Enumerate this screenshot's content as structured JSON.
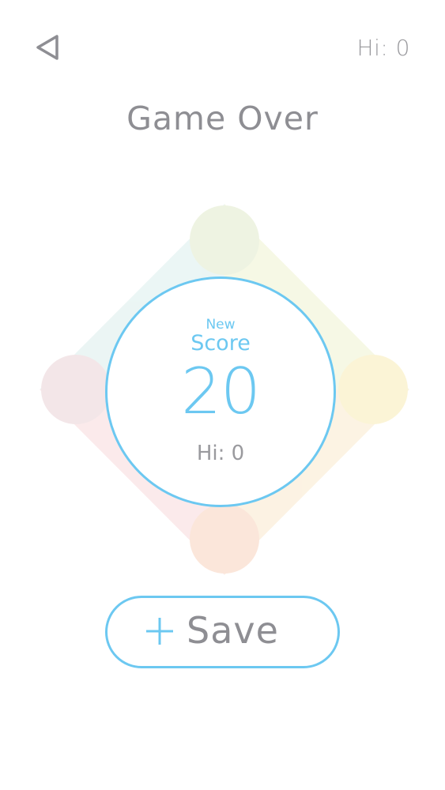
{
  "header": {
    "back_icon": "back-triangle-icon",
    "hi_score_text": "Hi: 0"
  },
  "title": "Game Over",
  "score_card": {
    "new_label": "New",
    "score_label": "Score",
    "score_value": "20",
    "hi_text": "Hi: 0"
  },
  "save_button": {
    "icon": "plus-icon",
    "label": "Save"
  },
  "colors": {
    "accent": "#6cc8f1",
    "text_gray": "#8e8e93",
    "pad_top": "#eef3e2",
    "pad_right": "#fbf4d6",
    "pad_bottom": "#fbe6da",
    "pad_left": "#f3e6e8"
  }
}
